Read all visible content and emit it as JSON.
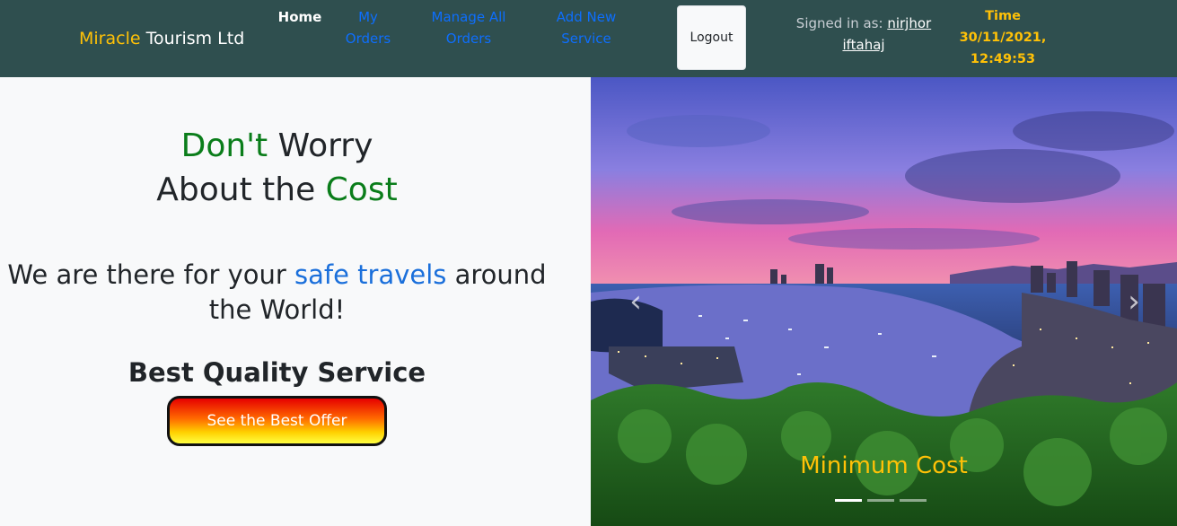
{
  "navbar": {
    "brand_accent": "Miracle",
    "brand_rest": " Tourism Ltd",
    "links": {
      "home": "Home",
      "my_orders": "My Orders",
      "manage_orders": "Manage All Orders",
      "add_service": "Add New Service"
    },
    "logout_label": "Logout",
    "signed_in_label": "Signed in as: ",
    "user_name": "nirjhor iftahaj",
    "time_label": "Time",
    "time_value": "30/11/2021, 12:49:53"
  },
  "hero": {
    "title": {
      "part1": "Don't",
      "part2": " Worry",
      "part3": "About the ",
      "part4": "Cost"
    },
    "subtitle": {
      "part1": "We are there for your ",
      "part2": "safe travels",
      "part3": " around the World!"
    },
    "quality": "Best Quality Service",
    "offer_button": "See the Best Offer"
  },
  "carousel": {
    "caption": "Minimum Cost",
    "prev_icon": "chevron-left-icon",
    "next_icon": "chevron-right-icon",
    "prev_glyph": "‹",
    "next_glyph": "›",
    "active_slide": 1,
    "slide_count": 3
  },
  "colors": {
    "navbar_bg": "#2f4f4f",
    "accent_yellow": "#ffc107",
    "green": "#0a7d1a",
    "blue": "#1a6fdb",
    "link_blue": "#0d6efd"
  }
}
